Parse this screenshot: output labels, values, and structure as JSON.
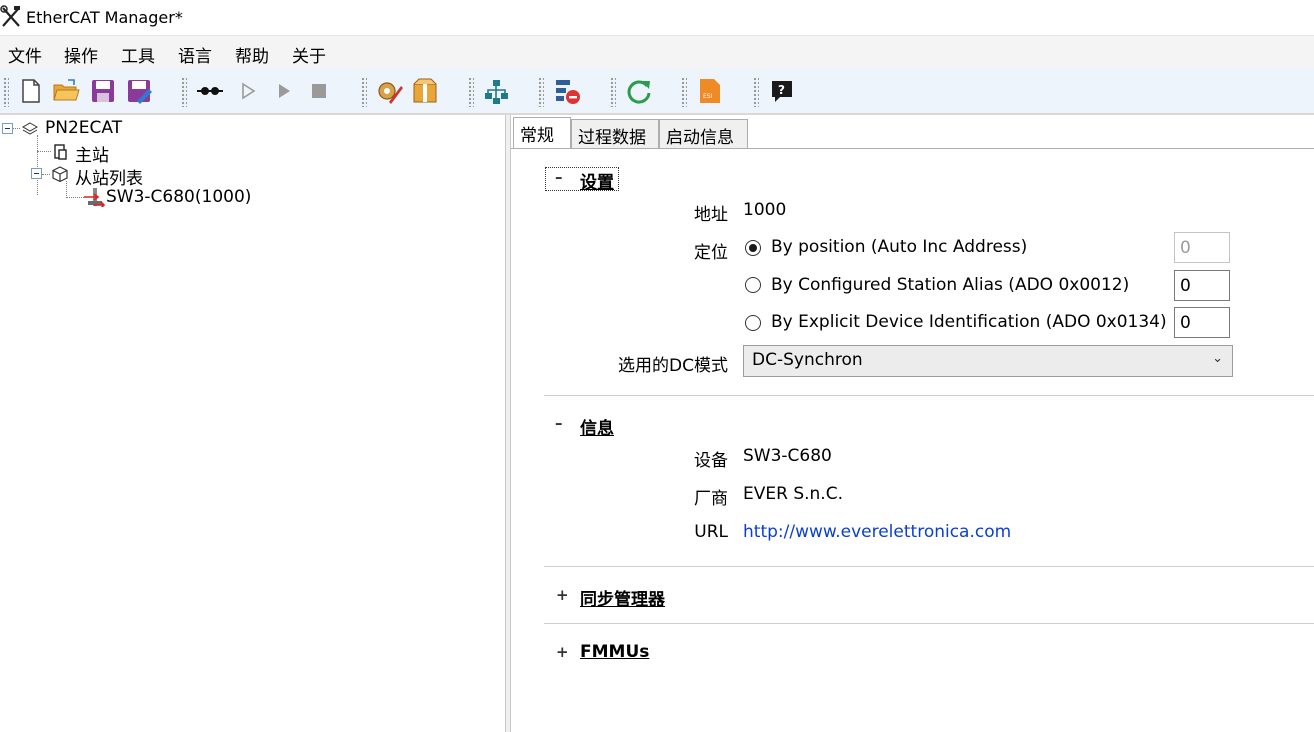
{
  "window": {
    "title": "EtherCAT Manager*",
    "app_icon": "tools-icon"
  },
  "menu": [
    "文件",
    "操作",
    "工具",
    "语言",
    "帮助",
    "关于"
  ],
  "toolbar": {
    "buttons": [
      "new-file-icon",
      "open-folder-icon",
      "save-icon",
      "save-as-icon",
      "connect-icon",
      "step-play-icon",
      "play-icon",
      "stop-icon",
      "settings-pencil-icon",
      "package-icon",
      "network-topology-icon",
      "remove-slave-icon",
      "refresh-icon",
      "esi-file-icon",
      "help-icon"
    ]
  },
  "tree": {
    "root": "PN2ECAT",
    "master": "主站",
    "slave_list": "从站列表",
    "slave": "SW3-C680(1000)"
  },
  "tabs": [
    "常规",
    "过程数据",
    "启动信息"
  ],
  "general": {
    "settings": {
      "header": "设置",
      "toggle": "–",
      "address_label": "地址",
      "address_value": "1000",
      "position_label": "定位",
      "options": [
        {
          "label": "By position (Auto Inc Address)",
          "value": "0",
          "checked": true
        },
        {
          "label": "By Configured Station Alias (ADO 0x0012)",
          "value": "0",
          "checked": false
        },
        {
          "label": "By Explicit Device Identification (ADO 0x0134)",
          "value": "0",
          "checked": false
        }
      ],
      "dc_label": "选用的DC模式",
      "dc_value": "DC-Synchron"
    },
    "info": {
      "header": "信息",
      "toggle": "–",
      "device_label": "设备",
      "device_value": "SW3-C680",
      "vendor_label": "厂商",
      "vendor_value": "EVER S.n.C.",
      "url_label": "URL",
      "url_value": "http://www.everelettronica.com"
    },
    "sync_manager": {
      "header": "同步管理器",
      "toggle": "+"
    },
    "fmmus": {
      "header": "FMMUs",
      "toggle": "+"
    }
  }
}
